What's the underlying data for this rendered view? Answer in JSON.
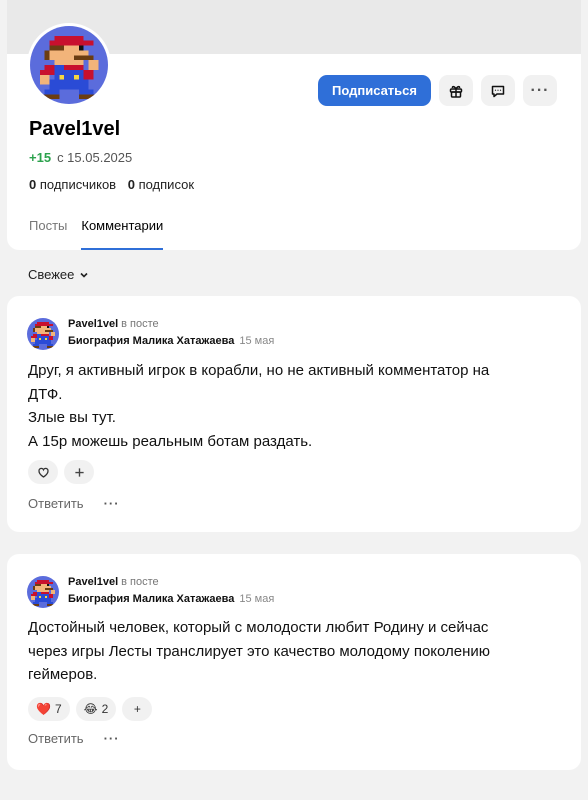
{
  "profile": {
    "name": "Pavel1vel",
    "karma": "+15",
    "since": "с 15.05.2025",
    "followers_count": "0",
    "followers_label": "подписчиков",
    "following_count": "0",
    "following_label": "подписок",
    "subscribe_label": "Подписаться",
    "more_label": "···"
  },
  "tabs": [
    {
      "label": "Посты",
      "active": false
    },
    {
      "label": "Комментарии",
      "active": true
    }
  ],
  "sort": {
    "label": "Свежее",
    "icon": "chevron-down-icon"
  },
  "comments": [
    {
      "author": "Pavel1vel",
      "in_post": "в посте",
      "post_title": "Биография Малика Хатажаева",
      "date": "15 мая",
      "lines": [
        "Друг, я активный игрок в корабли, но не активный комментатор на",
        "ДТФ.",
        "Злые вы тут.",
        "А 15р можешь реальным ботам раздать."
      ],
      "reactions": [],
      "reply_label": "Ответить",
      "more_label": "···"
    },
    {
      "author": "Pavel1vel",
      "in_post": "в посте",
      "post_title": "Биография Малика Хатажаева",
      "date": "15 мая",
      "lines": [
        "Достойный человек, который с молодости любит Родину и сейчас",
        "через игры Лесты транслирует это качество молодому поколению",
        "геймеров."
      ],
      "reactions": [
        {
          "emoji": "❤️",
          "count": "7"
        },
        {
          "emoji": "😂",
          "count": "2"
        }
      ],
      "add_reaction": "+",
      "reply_label": "Ответить",
      "more_label": "···"
    }
  ],
  "colors": {
    "accent": "#2f6fd8",
    "karma": "#2ca24d",
    "page_bg": "#f2f2f2"
  }
}
